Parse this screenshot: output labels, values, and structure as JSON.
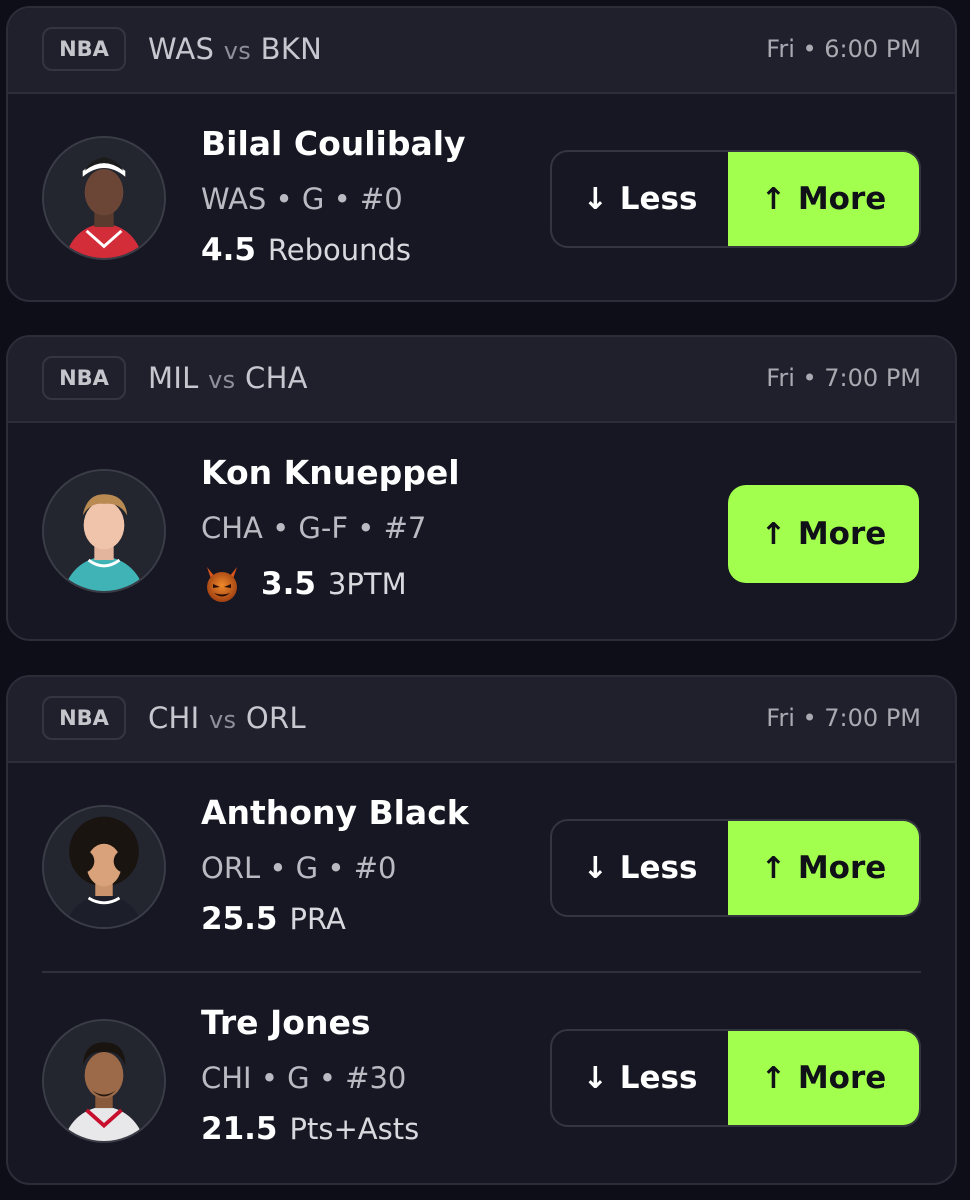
{
  "games": [
    {
      "league": "NBA",
      "team_a": "WAS",
      "vs": "vs",
      "team_b": "BKN",
      "time": "Fri • 6:00 PM",
      "players": [
        {
          "name": "Bilal Coulibaly",
          "meta": "WAS • G • #0",
          "line_value": "4.5",
          "line_stat": "Rebounds",
          "less_label": "Less",
          "more_label": "More",
          "jersey_color": "#d42d3a"
        }
      ]
    },
    {
      "league": "NBA",
      "team_a": "MIL",
      "vs": "vs",
      "team_b": "CHA",
      "time": "Fri • 7:00 PM",
      "players": [
        {
          "name": "Kon Knueppel",
          "meta": "CHA • G-F • #7",
          "line_value": "3.5",
          "line_stat": "3PTM",
          "more_label": "More",
          "jersey_color": "#3fb3b5",
          "badge_icon": "demon-icon"
        }
      ]
    },
    {
      "league": "NBA",
      "team_a": "CHI",
      "vs": "vs",
      "team_b": "ORL",
      "time": "Fri • 7:00 PM",
      "players": [
        {
          "name": "Anthony Black",
          "meta": "ORL • G • #0",
          "line_value": "25.5",
          "line_stat": "PRA",
          "less_label": "Less",
          "more_label": "More",
          "jersey_color": "#1c1e2a"
        },
        {
          "name": "Tre Jones",
          "meta": "CHI • G • #30",
          "line_value": "21.5",
          "line_stat": "Pts+Asts",
          "less_label": "Less",
          "more_label": "More",
          "jersey_color": "#e8e8ea"
        }
      ]
    }
  ],
  "colors": {
    "accent": "#a3ff4d",
    "background": "#0d0e18",
    "card": "#161722",
    "header": "#1f202b"
  }
}
